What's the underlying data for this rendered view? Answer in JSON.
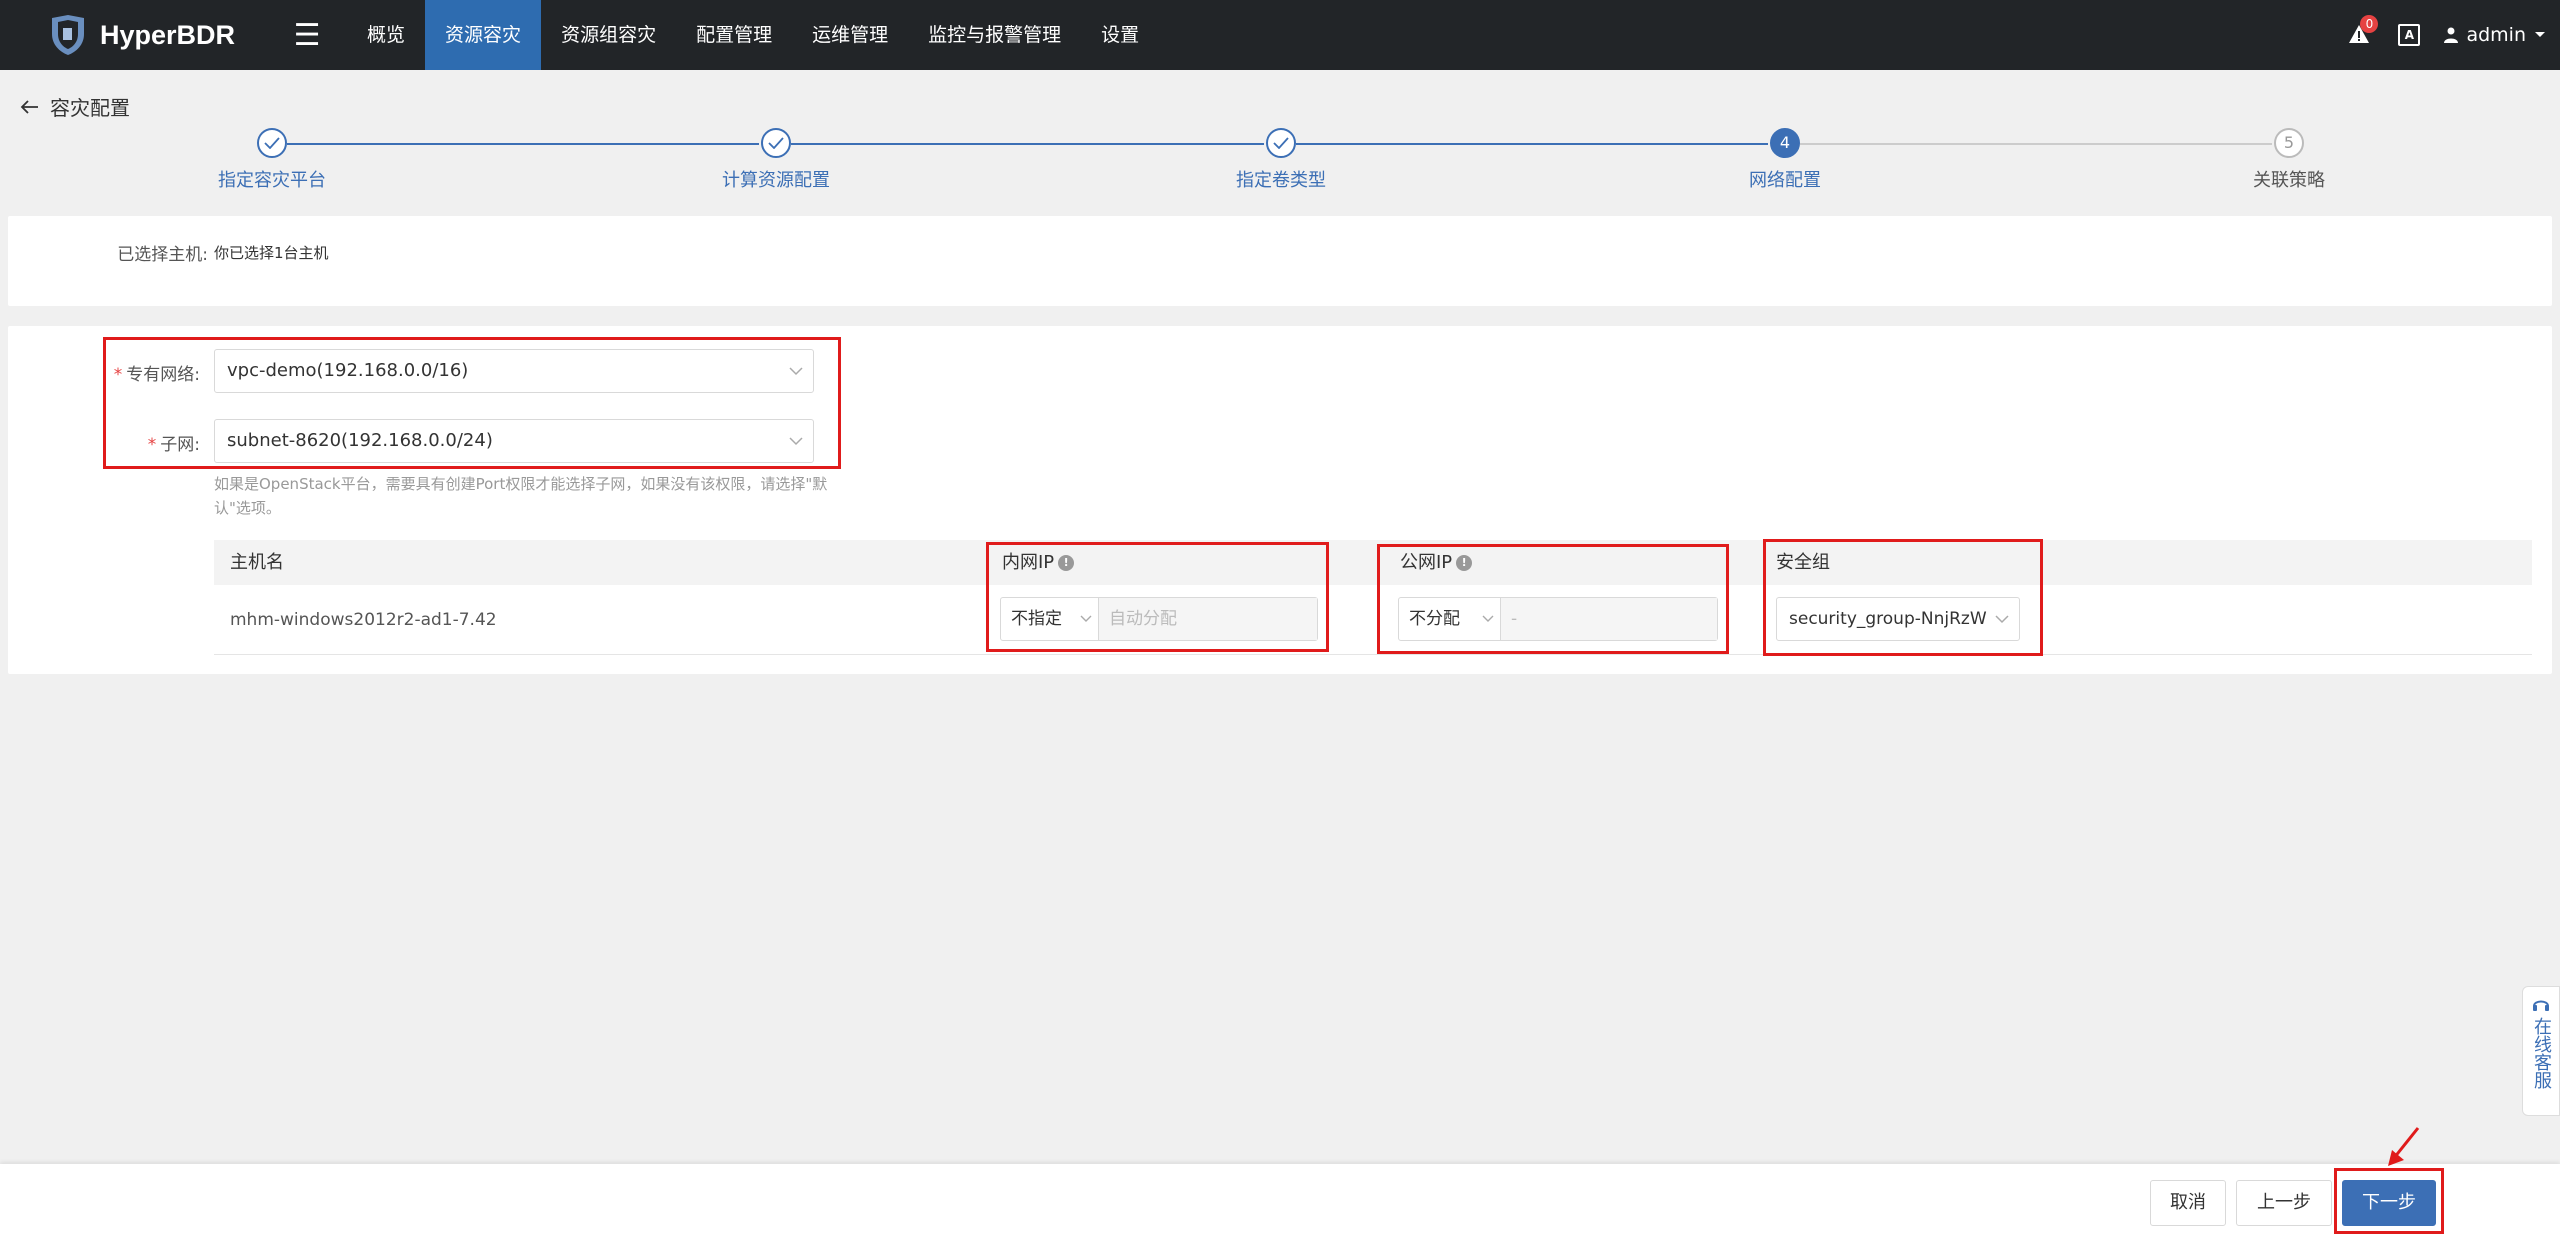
{
  "app": {
    "name": "HyperBDR"
  },
  "nav": {
    "items": [
      {
        "label": "概览"
      },
      {
        "label": "资源容灾",
        "active": true
      },
      {
        "label": "资源组容灾"
      },
      {
        "label": "配置管理"
      },
      {
        "label": "运维管理"
      },
      {
        "label": "监控与报警管理"
      },
      {
        "label": "设置"
      }
    ],
    "alert_count": "0",
    "user": "admin"
  },
  "breadcrumb": {
    "title": "容灾配置"
  },
  "steps": [
    {
      "label": "指定容灾平台",
      "state": "done"
    },
    {
      "label": "计算资源配置",
      "state": "done"
    },
    {
      "label": "指定卷类型",
      "state": "done"
    },
    {
      "label": "网络配置",
      "state": "current",
      "number": "4"
    },
    {
      "label": "关联策略",
      "state": "todo",
      "number": "5"
    }
  ],
  "selected_hosts": {
    "label": "已选择主机:",
    "value": "你已选择1台主机"
  },
  "network": {
    "vpc_label": "专有网络:",
    "vpc_value": "vpc-demo(192.168.0.0/16)",
    "subnet_label": "子网:",
    "subnet_value": "subnet-8620(192.168.0.0/24)",
    "hint": "如果是OpenStack平台，需要具有创建Port权限才能选择子网，如果没有该权限，请选择\"默认\"选项。"
  },
  "table": {
    "headers": {
      "host": "主机名",
      "private_ip": "内网IP",
      "public_ip": "公网IP",
      "security_group": "安全组"
    },
    "rows": [
      {
        "host": "mhm-windows2012r2-ad1-7.42",
        "private_ip_mode": "不指定",
        "private_ip_placeholder": "自动分配",
        "public_ip_mode": "不分配",
        "public_ip_value": "-",
        "security_group": "security_group-NnjRzW"
      }
    ]
  },
  "footer": {
    "cancel": "取消",
    "prev": "上一步",
    "next": "下一步"
  },
  "service": {
    "label": "在线客服"
  },
  "colors": {
    "primary": "#3c6fb5",
    "topbar": "#222528",
    "highlight": "#e01b1b"
  }
}
